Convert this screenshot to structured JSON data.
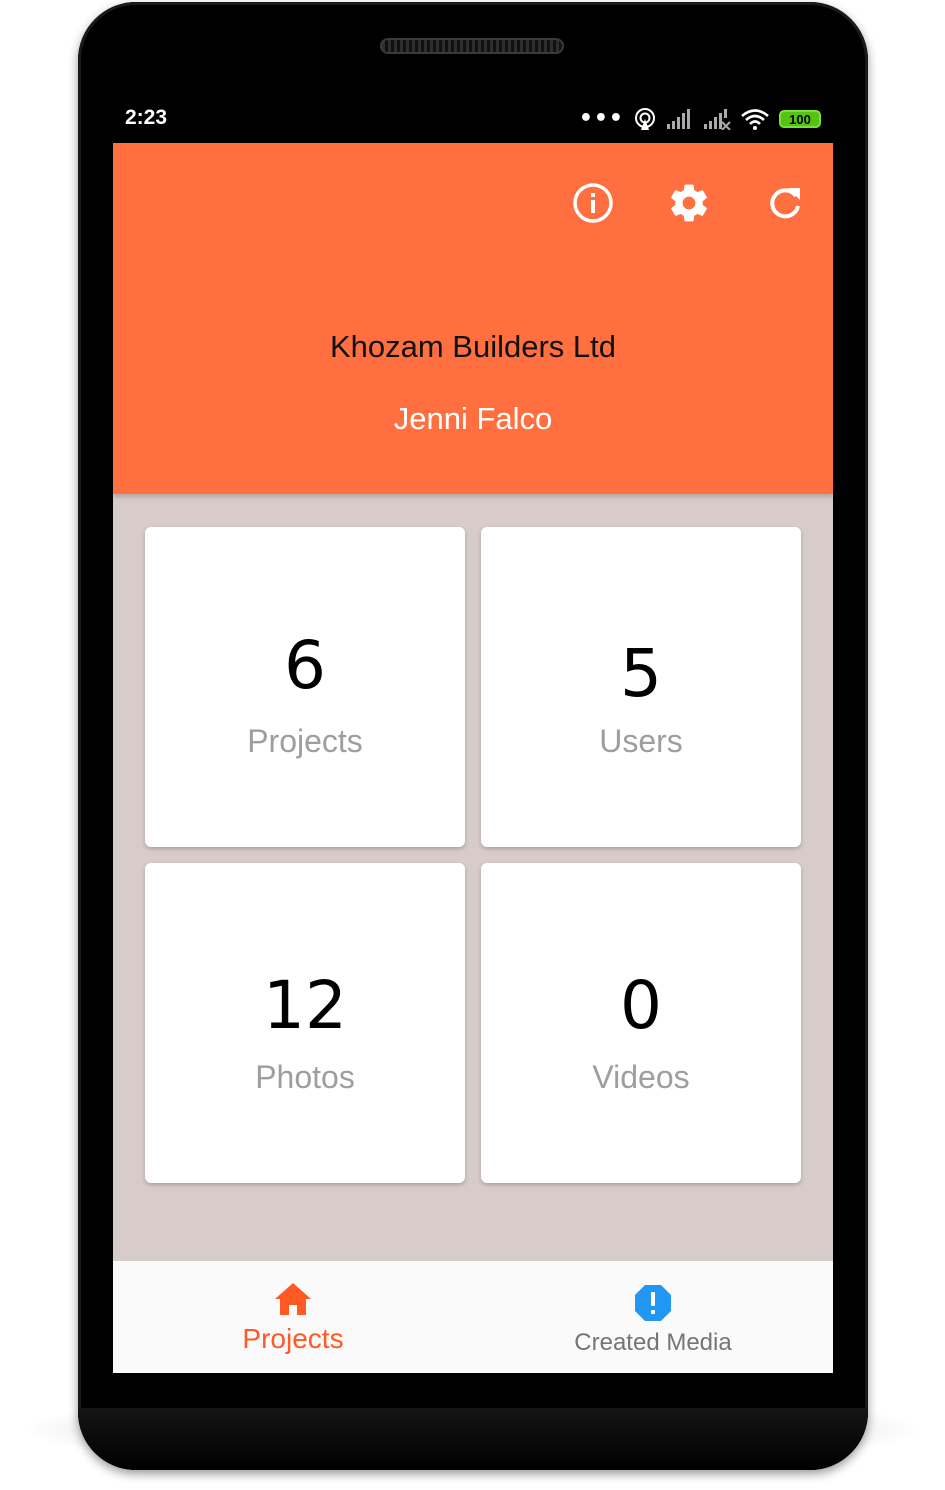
{
  "status_bar": {
    "time": "2:23",
    "dots": "•••",
    "battery": "100",
    "icons": [
      "hotspot-icon",
      "signal-icon",
      "signal-no-service-icon",
      "wifi-icon",
      "battery-icon"
    ]
  },
  "header": {
    "background_color": "#ff6f40",
    "actions": [
      "info-icon",
      "settings-icon",
      "refresh-icon"
    ],
    "company_name": "Khozam Builders Ltd",
    "user_name": "Jenni Falco"
  },
  "stats": [
    {
      "value": "6",
      "label": "Projects"
    },
    {
      "value": "5",
      "label": "Users"
    },
    {
      "value": "12",
      "label": "Photos"
    },
    {
      "value": "0",
      "label": "Videos"
    }
  ],
  "bottom_nav": {
    "items": [
      {
        "label": "Projects",
        "icon": "home-icon",
        "active": true,
        "color": "#ff5a23"
      },
      {
        "label": "Created Media",
        "icon": "alert-badge-icon",
        "active": false,
        "color": "#2196f3"
      }
    ]
  }
}
